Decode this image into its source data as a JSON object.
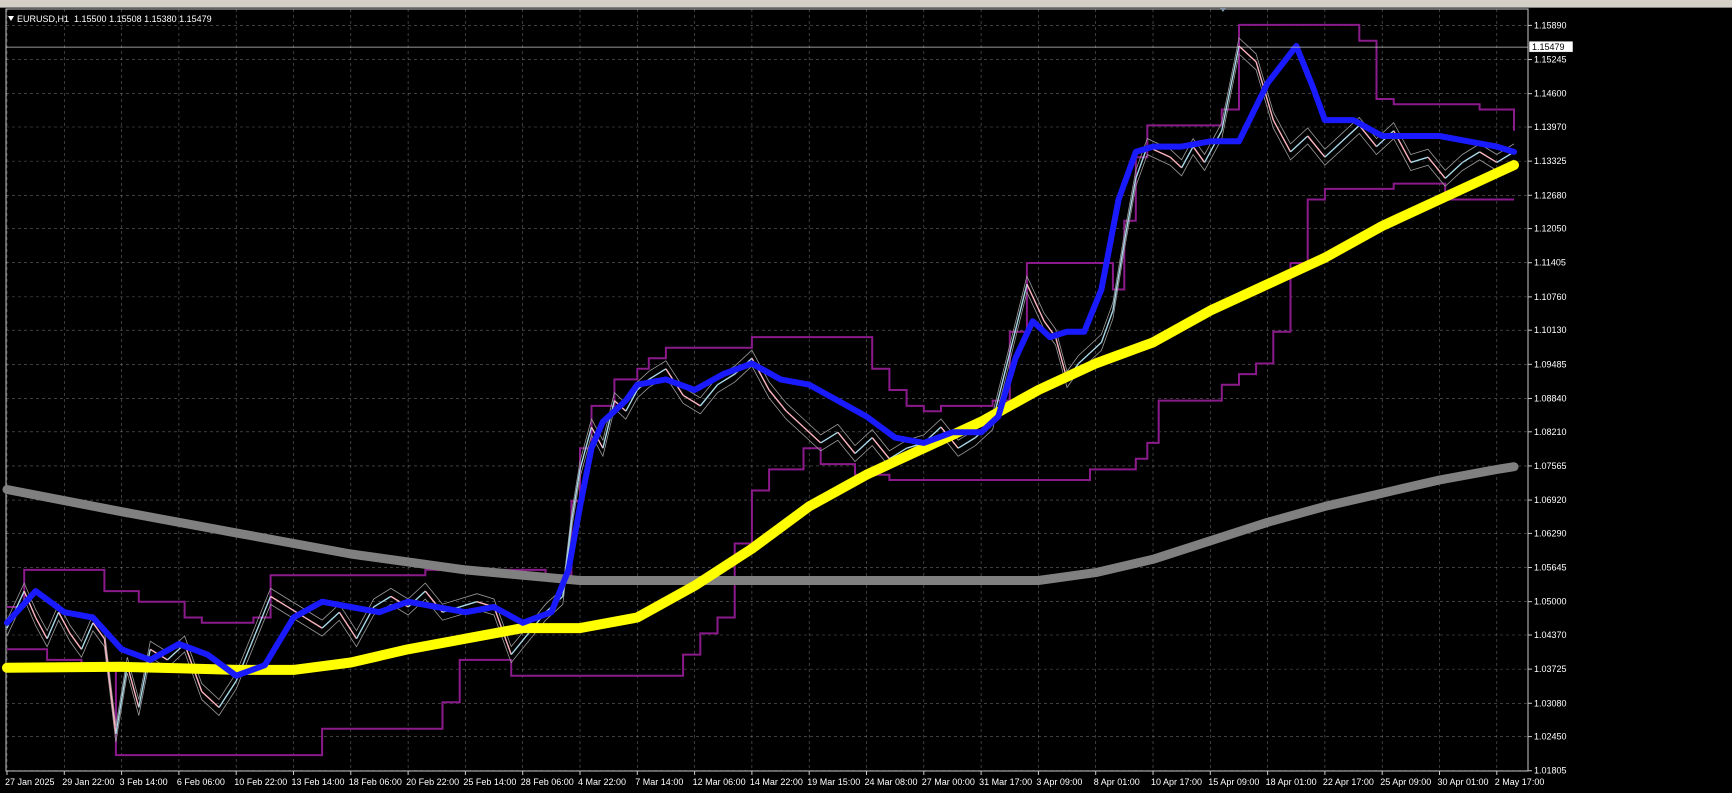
{
  "symbol_info": {
    "symbol": "EURUSD,H1",
    "ohlc": "1.15500 1.15508 1.15380 1.15479"
  },
  "price_label": "1.15479",
  "colors": {
    "background": "#000000",
    "grid": "#b4b4b4",
    "text": "#ffffff",
    "ma_fast": "#1a1aff",
    "ma_mid": "#ffff00",
    "ma_slow": "#808080",
    "channel": "#8b1a8b",
    "price_up": "#a8d8e8",
    "price_down": "#ffb6c1",
    "envelope": "#9a9a9a"
  },
  "chart_data": {
    "type": "line",
    "symbol": "EURUSD",
    "timeframe": "H1",
    "ylim": [
      1.018,
      1.162
    ],
    "y_ticks": [
      "1.15890",
      "1.15245",
      "1.14600",
      "1.13970",
      "1.13325",
      "1.12680",
      "1.12050",
      "1.11405",
      "1.10760",
      "1.10130",
      "1.09485",
      "1.08840",
      "1.08210",
      "1.07565",
      "1.06920",
      "1.06290",
      "1.05645",
      "1.05000",
      "1.04370",
      "1.03725",
      "1.03080",
      "1.02450",
      "1.01805"
    ],
    "x_ticks": [
      "27 Jan 2025",
      "29 Jan 22:00",
      "3 Feb 14:00",
      "6 Feb 06:00",
      "10 Feb 22:00",
      "13 Feb 14:00",
      "18 Feb 06:00",
      "20 Feb 22:00",
      "25 Feb 14:00",
      "28 Feb 06:00",
      "4 Mar 22:00",
      "7 Mar 14:00",
      "12 Mar 06:00",
      "14 Mar 22:00",
      "19 Mar 15:00",
      "24 Mar 08:00",
      "27 Mar 00:00",
      "31 Mar 17:00",
      "3 Apr 09:00",
      "8 Apr 01:00",
      "10 Apr 17:00",
      "15 Apr 09:00",
      "18 Apr 01:00",
      "22 Apr 17:00",
      "25 Apr 09:00",
      "30 Apr 01:00",
      "2 May 17:00"
    ],
    "last_price": 1.15479,
    "series": [
      {
        "role": "price",
        "x": [
          0,
          0.3,
          0.5,
          0.7,
          0.9,
          1.1,
          1.3,
          1.5,
          1.7,
          1.9,
          2.1,
          2.3,
          2.5,
          2.8,
          3.1,
          3.4,
          3.7,
          4.0,
          4.3,
          4.6,
          4.9,
          5.2,
          5.5,
          5.8,
          6.1,
          6.4,
          6.7,
          7.0,
          7.3,
          7.6,
          7.9,
          8.2,
          8.5,
          8.8,
          9.1,
          9.4,
          9.7,
          9.85,
          10.0,
          10.2,
          10.4,
          10.6,
          10.8,
          11.0,
          11.2,
          11.5,
          11.8,
          12.1,
          12.4,
          12.7,
          13.0,
          13.3,
          13.6,
          13.9,
          14.2,
          14.5,
          14.8,
          15.1,
          15.4,
          15.7,
          16.0,
          16.3,
          16.6,
          16.9,
          17.2,
          17.5,
          17.8,
          18.1,
          18.3,
          18.5,
          18.7,
          18.9,
          19.1,
          19.3,
          19.5,
          19.7,
          19.9,
          20.1,
          20.3,
          20.5,
          20.7,
          20.9,
          21.2,
          21.5,
          21.8,
          22.1,
          22.4,
          22.7,
          23.0,
          23.3,
          23.6,
          23.9,
          24.2,
          24.5,
          24.8,
          25.1,
          25.4,
          25.7,
          26.0,
          26.3
        ],
        "y": [
          1.045,
          1.052,
          1.047,
          1.043,
          1.048,
          1.044,
          1.041,
          1.046,
          1.043,
          1.025,
          1.038,
          1.03,
          1.041,
          1.039,
          1.042,
          1.033,
          1.03,
          1.035,
          1.043,
          1.051,
          1.049,
          1.047,
          1.045,
          1.048,
          1.043,
          1.049,
          1.051,
          1.049,
          1.052,
          1.048,
          1.049,
          1.05,
          1.049,
          1.04,
          1.044,
          1.048,
          1.051,
          1.065,
          1.075,
          1.083,
          1.079,
          1.088,
          1.086,
          1.09,
          1.092,
          1.094,
          1.089,
          1.087,
          1.091,
          1.093,
          1.096,
          1.09,
          1.086,
          1.083,
          1.08,
          1.082,
          1.078,
          1.081,
          1.077,
          1.079,
          1.08,
          1.083,
          1.079,
          1.081,
          1.084,
          1.097,
          1.11,
          1.103,
          1.1,
          1.092,
          1.095,
          1.097,
          1.099,
          1.105,
          1.118,
          1.13,
          1.136,
          1.135,
          1.134,
          1.132,
          1.136,
          1.133,
          1.139,
          1.155,
          1.152,
          1.141,
          1.135,
          1.138,
          1.134,
          1.137,
          1.14,
          1.136,
          1.139,
          1.133,
          1.134,
          1.13,
          1.133,
          1.135,
          1.133,
          1.135
        ]
      },
      {
        "role": "ma_fast",
        "x": [
          0,
          0.5,
          1.0,
          1.5,
          2.0,
          2.5,
          3.0,
          3.5,
          4.0,
          4.5,
          5.0,
          5.5,
          6.0,
          6.5,
          7.0,
          7.5,
          8.0,
          8.5,
          9.0,
          9.5,
          9.8,
          10.0,
          10.2,
          10.4,
          10.6,
          10.8,
          11.0,
          11.5,
          12.0,
          12.5,
          13.0,
          13.5,
          14.0,
          14.5,
          15.0,
          15.5,
          16.0,
          16.5,
          17.0,
          17.3,
          17.6,
          17.9,
          18.2,
          18.5,
          18.8,
          19.1,
          19.4,
          19.7,
          20.0,
          20.5,
          21.0,
          21.5,
          22.0,
          22.5,
          22.8,
          23.0,
          23.5,
          24.0,
          24.5,
          25.0,
          25.5,
          26.0,
          26.3
        ],
        "y": [
          1.046,
          1.052,
          1.048,
          1.047,
          1.041,
          1.039,
          1.042,
          1.04,
          1.036,
          1.038,
          1.047,
          1.05,
          1.049,
          1.048,
          1.05,
          1.049,
          1.048,
          1.049,
          1.046,
          1.048,
          1.056,
          1.068,
          1.079,
          1.084,
          1.086,
          1.088,
          1.091,
          1.092,
          1.09,
          1.093,
          1.095,
          1.092,
          1.091,
          1.088,
          1.085,
          1.081,
          1.08,
          1.082,
          1.082,
          1.085,
          1.096,
          1.103,
          1.1,
          1.101,
          1.101,
          1.109,
          1.126,
          1.135,
          1.136,
          1.136,
          1.137,
          1.137,
          1.148,
          1.155,
          1.147,
          1.141,
          1.141,
          1.138,
          1.138,
          1.138,
          1.137,
          1.136,
          1.135
        ]
      },
      {
        "role": "ma_mid",
        "x": [
          0,
          1,
          2,
          3,
          4,
          5,
          6,
          7,
          8,
          9,
          10,
          11,
          12,
          13,
          14,
          15,
          16,
          17,
          18,
          19,
          20,
          21,
          22,
          23,
          24,
          25,
          26,
          26.3
        ],
        "y": [
          1.0375,
          1.0376,
          1.0377,
          1.0374,
          1.0371,
          1.0371,
          1.0385,
          1.041,
          1.043,
          1.045,
          1.045,
          1.047,
          1.053,
          1.06,
          1.068,
          1.074,
          1.079,
          1.084,
          1.09,
          1.095,
          1.099,
          1.105,
          1.11,
          1.115,
          1.121,
          1.126,
          1.131,
          1.1325
        ]
      },
      {
        "role": "ma_slow",
        "x": [
          0,
          2,
          4,
          6,
          8,
          10,
          12,
          14,
          16,
          18,
          19,
          20,
          21,
          22,
          23,
          24,
          25,
          26,
          26.3
        ],
        "y": [
          1.0712,
          1.067,
          1.063,
          1.059,
          1.056,
          1.054,
          1.054,
          1.054,
          1.054,
          1.054,
          1.0555,
          1.058,
          1.0615,
          1.065,
          1.068,
          1.0705,
          1.073,
          1.075,
          1.0755
        ]
      }
    ]
  }
}
